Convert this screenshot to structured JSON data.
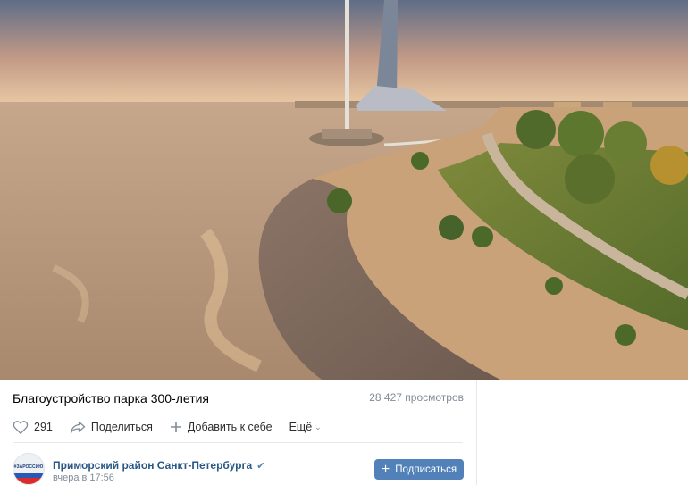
{
  "video": {
    "title": "Благоустройство парка 300-летия",
    "views": "28 427 просмотров"
  },
  "actions": {
    "likes": "291",
    "share_label": "Поделиться",
    "add_label": "Добавить к себе",
    "more_label": "Ещё"
  },
  "channel": {
    "name": "Приморский район Санкт-Петербурга",
    "avatar_text": "#ЗАРОССИЮ",
    "date": "вчера в 17:56",
    "subscribe_label": "Подписаться"
  },
  "colors": {
    "link": "#2a5885",
    "button": "#5181b8",
    "muted": "#818c99"
  }
}
